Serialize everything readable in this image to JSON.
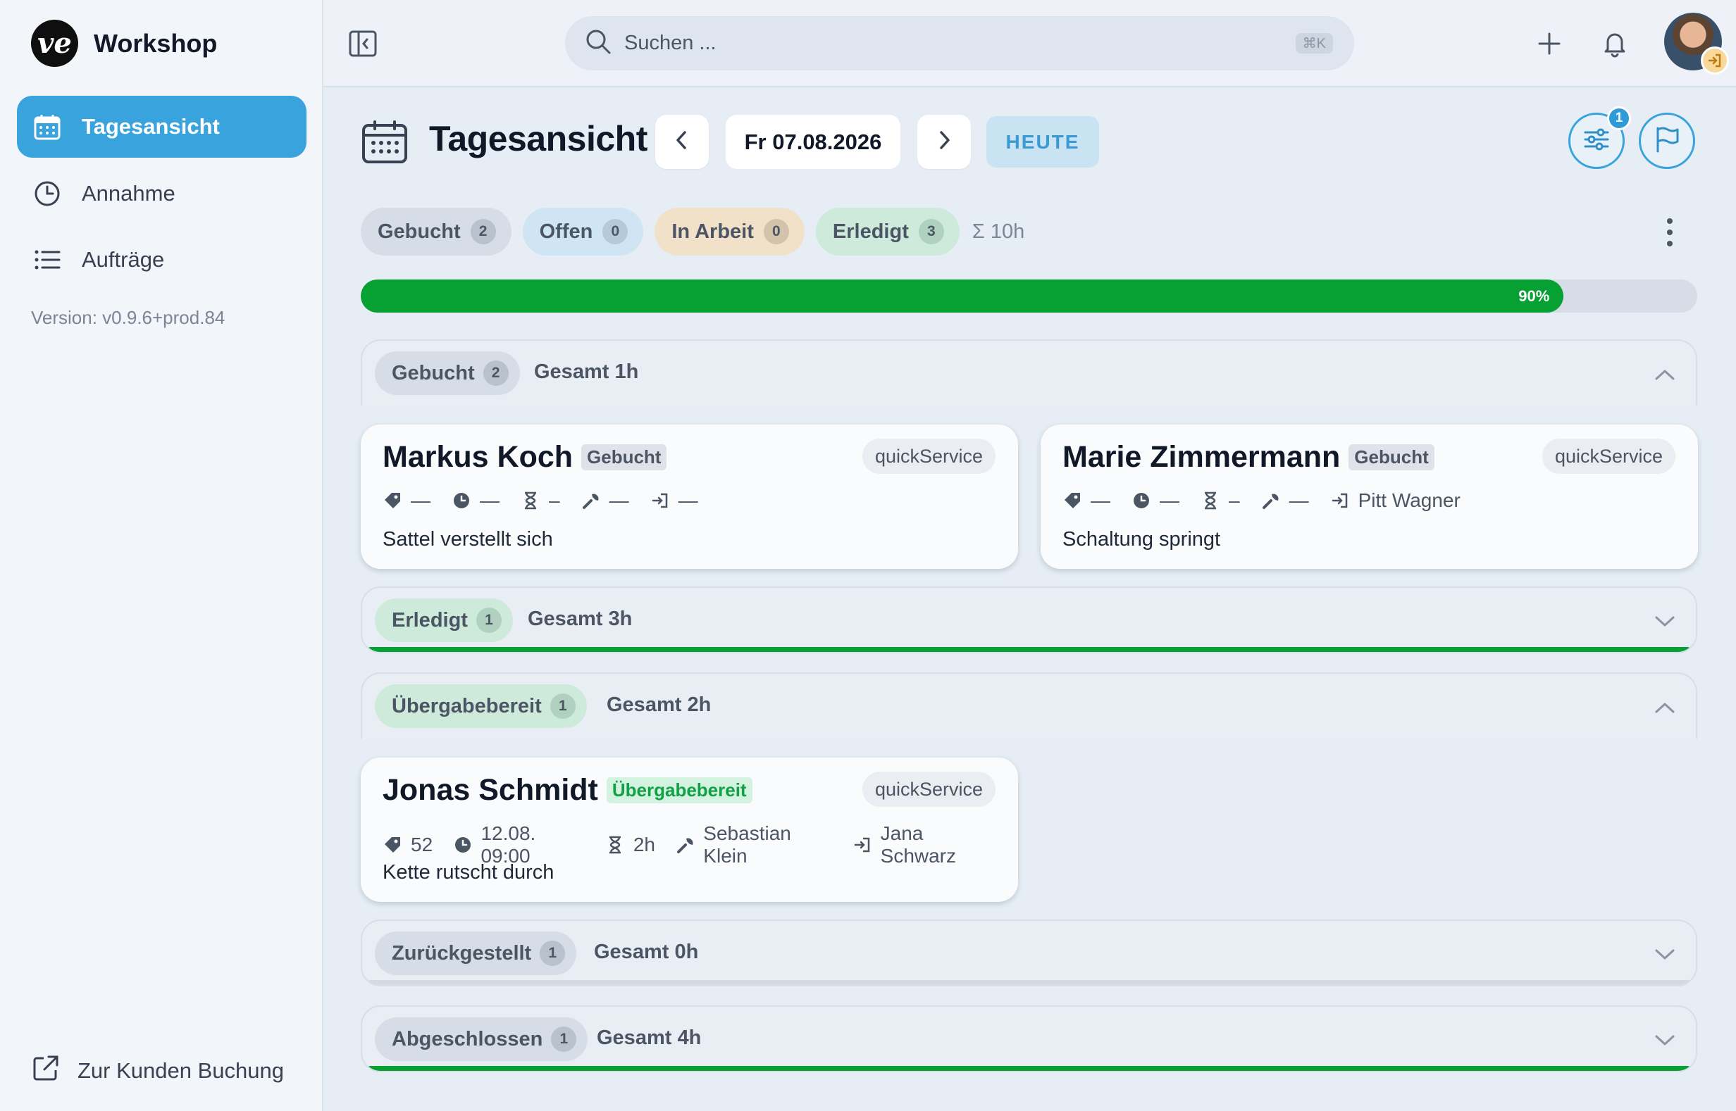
{
  "app": {
    "brand_name": "Workshop",
    "brand_logo": "ve",
    "version": "Version: v0.9.6+prod.84",
    "accent_color": "#38a3dd",
    "success_color": "#06a033"
  },
  "sidebar": {
    "items": [
      {
        "label": "Tagesansicht",
        "icon": "calendar-icon",
        "active": true
      },
      {
        "label": "Annahme",
        "icon": "clock-icon",
        "active": false
      },
      {
        "label": "Aufträge",
        "icon": "list-icon",
        "active": false
      }
    ],
    "customer_link": "Zur Kunden Buchung"
  },
  "topbar": {
    "search_placeholder": "Suchen ...",
    "search_shortcut": "⌘K",
    "icons": [
      "sidebar-toggle-icon",
      "plus-icon",
      "bell-icon"
    ]
  },
  "header": {
    "title": "Tagesansicht",
    "date": "Fr 07.08.2026",
    "today_label": "HEUTE",
    "filter_badge": "1"
  },
  "summary": {
    "chips": [
      {
        "label": "Gebucht",
        "count": "2",
        "color": "gray"
      },
      {
        "label": "Offen",
        "count": "0",
        "color": "blue"
      },
      {
        "label": "In Arbeit",
        "count": "0",
        "color": "orange"
      },
      {
        "label": "Erledigt",
        "count": "3",
        "color": "green"
      }
    ],
    "total": "Σ 10h",
    "progress_label": "90%",
    "progress_value": 0.9
  },
  "groups": [
    {
      "label": "Gebucht",
      "count": "2",
      "total": "Gesamt 1h",
      "expanded": true,
      "cards": [
        {
          "name": "Markus Koch",
          "status": "Gebucht",
          "tag": "quickService",
          "number": "—",
          "time": "—",
          "duration": "–",
          "mechanic": "—",
          "handover": "—",
          "description": "Sattel verstellt sich"
        },
        {
          "name": "Marie Zimmermann",
          "status": "Gebucht",
          "tag": "quickService",
          "number": "—",
          "time": "—",
          "duration": "–",
          "mechanic": "—",
          "handover": "Pitt Wagner",
          "description": "Schaltung springt"
        }
      ]
    },
    {
      "label": "Erledigt",
      "count": "1",
      "total": "Gesamt 3h",
      "expanded": false,
      "bar_progress": 1.0
    },
    {
      "label": "Übergabebereit",
      "count": "1",
      "total": "Gesamt 2h",
      "expanded": true,
      "cards": [
        {
          "name": "Jonas Schmidt",
          "status": "Übergabebereit",
          "tag": "quickService",
          "number": "52",
          "time": "12.08. 09:00",
          "duration": "2h",
          "mechanic": "Sebastian Klein",
          "handover": "Jana Schwarz",
          "description": "Kette rutscht durch"
        }
      ]
    },
    {
      "label": "Zurückgestellt",
      "count": "1",
      "total": "Gesamt 0h",
      "expanded": false,
      "bar_progress": 0.0
    },
    {
      "label": "Abgeschlossen",
      "count": "1",
      "total": "Gesamt 4h",
      "expanded": false,
      "bar_progress": 1.0
    }
  ]
}
